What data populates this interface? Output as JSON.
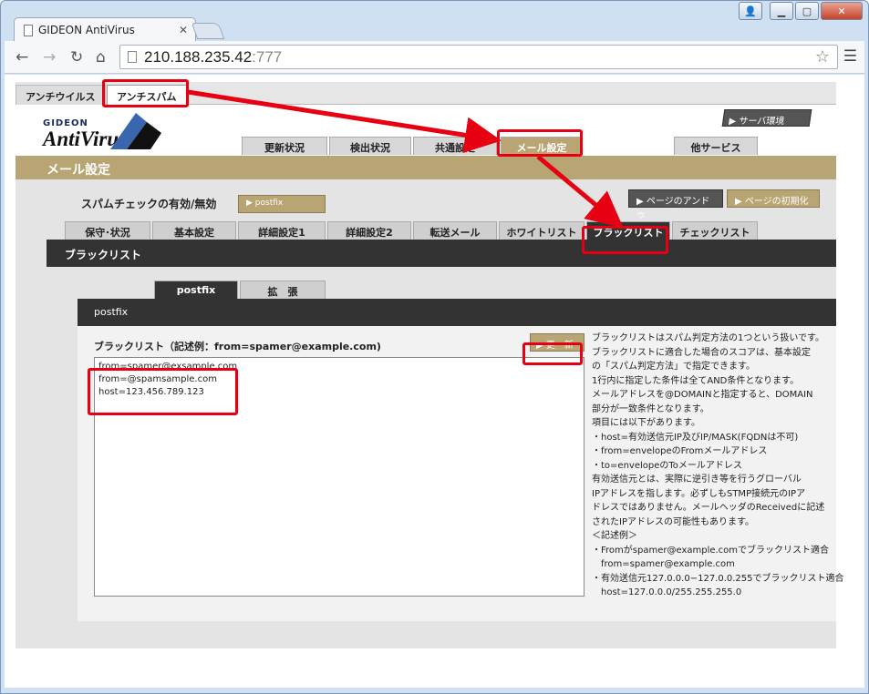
{
  "browser": {
    "tab_title": "GIDEON AntiVirus",
    "url_host": "210.188.235.42",
    "url_port": ":777"
  },
  "top_tabs": [
    {
      "label": "アンチウイルス"
    },
    {
      "label": "アンチスパム"
    }
  ],
  "logo": {
    "brand": "GIDEON",
    "name": "AntiVirus"
  },
  "server_button": "▶ サーバ環境",
  "main_tabs": [
    {
      "label": "更新状況"
    },
    {
      "label": "検出状況"
    },
    {
      "label": "共通設定"
    },
    {
      "label": "メール設定"
    },
    {
      "label": "他サービス"
    }
  ],
  "section_title": "メール設定",
  "spam_check_label": "スパムチェックの有効/無効",
  "postfix_button": "▶ postfix",
  "undo_button": "▶ ページのアンドゥ",
  "init_button": "▶ ページの初期化",
  "sub_tabs": [
    {
      "label": "保守･状況"
    },
    {
      "label": "基本設定"
    },
    {
      "label": "詳細設定1"
    },
    {
      "label": "詳細設定2"
    },
    {
      "label": "転送メール"
    },
    {
      "label": "ホワイトリスト"
    },
    {
      "label": "ブラックリスト"
    },
    {
      "label": "チェックリスト"
    }
  ],
  "page_heading": "ブラックリスト",
  "inner_tabs": [
    {
      "label": "postfix"
    },
    {
      "label": "拡　張"
    }
  ],
  "inner_heading": "postfix",
  "blacklist_label": "ブラックリスト（記述例：from=spamer@example.com)",
  "update_button": "▶ 更　新",
  "blacklist_entries": [
    "from=spamer@exsample.com",
    "from=@spamsample.com",
    "host=123.456.789.123"
  ],
  "help_lines": [
    "ブラックリストはスパム判定方法の1つという扱いです。",
    "ブラックリストに適合した場合のスコアは、基本設定",
    "の「スパム判定方法」で指定できます。",
    "1行内に指定した条件は全てAND条件となります。",
    "メールアドレスを@DOMAINと指定すると、DOMAIN",
    "部分が一致条件となります。",
    "項目には以下があります。",
    "・host=有効送信元IP及びIP/MASK(FQDNは不可)",
    "・from=envelopeのFromメールアドレス",
    "・to=envelopeのToメールアドレス",
    "有効送信元とは、実際に逆引き等を行うグローバル",
    "IPアドレスを指します。必ずしもSTMP接続元のIPア",
    "ドレスではありません。メールヘッダのReceivedに記述",
    "されたIPアドレスの可能性もあります。",
    "＜記述例＞",
    "・Fromがspamer@example.comでブラックリスト適合",
    "　from=spamer@example.com",
    "・有効送信元127.0.0.0−127.0.0.255でブラックリスト適合",
    "　host=127.0.0.0/255.255.255.0"
  ],
  "colors": {
    "accent": "#b9a473",
    "annotation": "#e60012",
    "dark": "#333333"
  }
}
